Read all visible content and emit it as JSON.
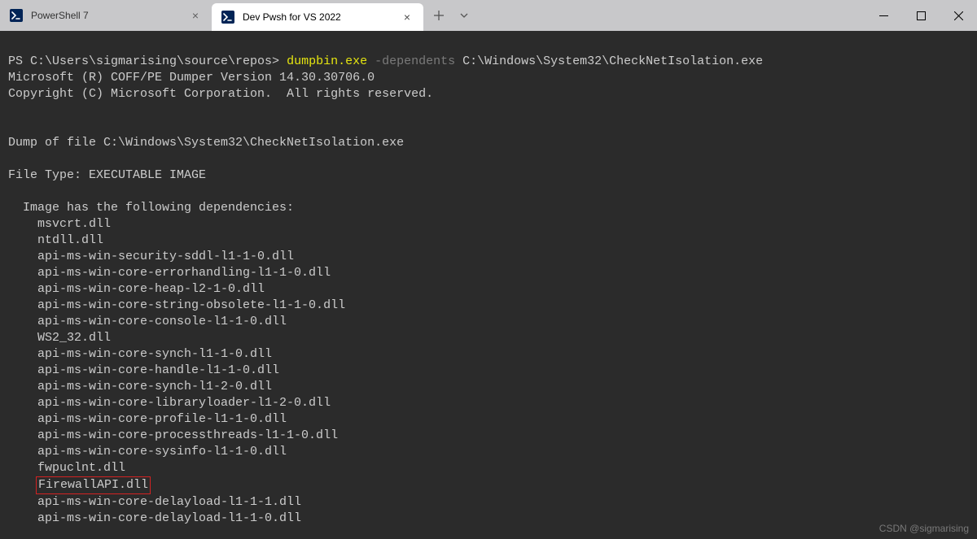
{
  "tabs": [
    {
      "title": "PowerShell 7"
    },
    {
      "title": "Dev Pwsh for VS 2022"
    }
  ],
  "windowControls": {
    "minimize": "—",
    "maximize": "☐",
    "close": "✕"
  },
  "prompt": {
    "ps": "PS C:\\Users\\sigmarising\\source\\repos> ",
    "exe": "dumpbin.exe ",
    "flag": "-dependents ",
    "arg": "C:\\Windows\\System32\\CheckNetIsolation.exe"
  },
  "outputHeader": [
    "Microsoft (R) COFF/PE Dumper Version 14.30.30706.0",
    "Copyright (C) Microsoft Corporation.  All rights reserved.",
    "",
    "",
    "Dump of file C:\\Windows\\System32\\CheckNetIsolation.exe",
    "",
    "File Type: EXECUTABLE IMAGE",
    "",
    "  Image has the following dependencies:",
    ""
  ],
  "dependencies": [
    "msvcrt.dll",
    "ntdll.dll",
    "api-ms-win-security-sddl-l1-1-0.dll",
    "api-ms-win-core-errorhandling-l1-1-0.dll",
    "api-ms-win-core-heap-l2-1-0.dll",
    "api-ms-win-core-string-obsolete-l1-1-0.dll",
    "api-ms-win-core-console-l1-1-0.dll",
    "WS2_32.dll",
    "api-ms-win-core-synch-l1-1-0.dll",
    "api-ms-win-core-handle-l1-1-0.dll",
    "api-ms-win-core-synch-l1-2-0.dll",
    "api-ms-win-core-libraryloader-l1-2-0.dll",
    "api-ms-win-core-profile-l1-1-0.dll",
    "api-ms-win-core-processthreads-l1-1-0.dll",
    "api-ms-win-core-sysinfo-l1-1-0.dll",
    "fwpuclnt.dll"
  ],
  "highlighted": "FirewallAPI.dll",
  "dependenciesAfter": [
    "api-ms-win-core-delayload-l1-1-1.dll",
    "api-ms-win-core-delayload-l1-1-0.dll"
  ],
  "depIndent": "    ",
  "watermark": "CSDN @sigmarising"
}
